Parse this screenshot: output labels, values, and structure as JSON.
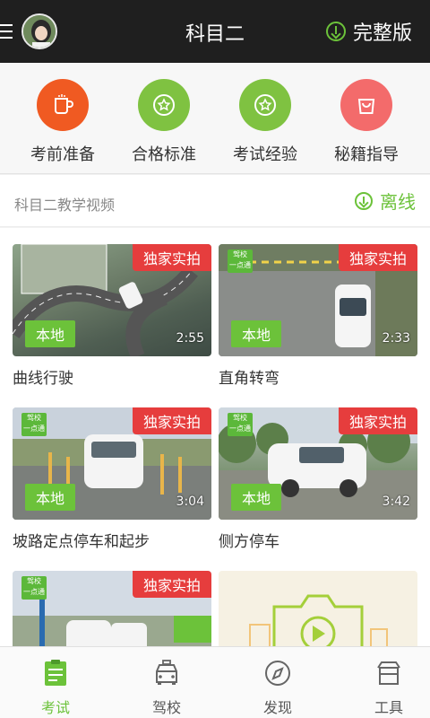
{
  "topbar": {
    "title": "科目二",
    "full_version_label": "完整版"
  },
  "quick_menu": [
    {
      "label": "考前准备",
      "color": "#f05a22",
      "icon": "cup-icon"
    },
    {
      "label": "合格标准",
      "color": "#7fc241",
      "icon": "star-badge-icon"
    },
    {
      "label": "考试经验",
      "color": "#7fc241",
      "icon": "star-badge-icon"
    },
    {
      "label": "秘籍指导",
      "color": "#f36b6b",
      "icon": "bag-icon"
    }
  ],
  "section": {
    "title": "科目二教学视频",
    "offline_label": "离线"
  },
  "videos": [
    {
      "title": "曲线行驶",
      "badge": "独家实拍",
      "tag": "本地",
      "duration": "2:55"
    },
    {
      "title": "直角转弯",
      "badge": "独家实拍",
      "tag": "本地",
      "duration": "2:33"
    },
    {
      "title": "坡路定点停车和起步",
      "badge": "独家实拍",
      "tag": "本地",
      "duration": "3:04"
    },
    {
      "title": "侧方停车",
      "badge": "独家实拍",
      "tag": "本地",
      "duration": "3:42"
    },
    {
      "title": "",
      "badge": "独家实拍",
      "tag": "",
      "duration": ""
    }
  ],
  "logo_text": "驾校\n一点通",
  "bottom_nav": [
    {
      "label": "考试",
      "icon": "exam-icon",
      "active": true
    },
    {
      "label": "驾校",
      "icon": "taxi-icon",
      "active": false
    },
    {
      "label": "发现",
      "icon": "compass-icon",
      "active": false
    },
    {
      "label": "工具",
      "icon": "toolbox-icon",
      "active": false
    }
  ],
  "colors": {
    "accent": "#6cc23a",
    "badge": "#e63d3d",
    "topbar": "#1f1f1f"
  }
}
